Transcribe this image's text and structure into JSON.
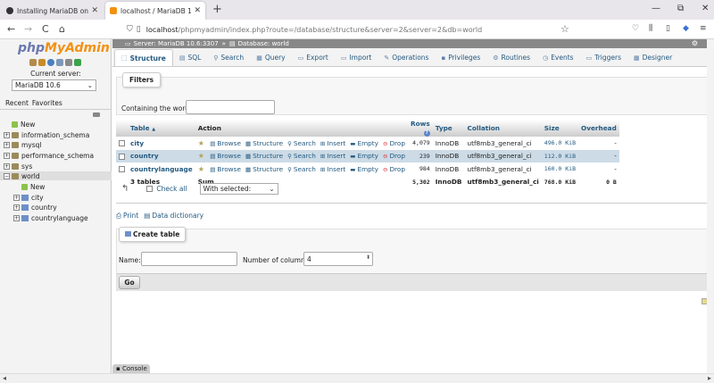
{
  "browser": {
    "tabs": [
      {
        "title": "Installing MariaDB on MS Wind",
        "close": "✕"
      },
      {
        "title": "localhost / MariaDB 10.6 / wor",
        "close": "✕"
      }
    ],
    "new_tab": "+",
    "window_controls": [
      "—",
      "⧉",
      "✕"
    ],
    "nav": {
      "back": "←",
      "forward": "→",
      "reload": "C",
      "home": "⌂"
    },
    "url_host": "localhost",
    "url_path": "/phpmyadmin/index.php?route=/database/structure&server=2&server=2&db=world",
    "right_icons": [
      "♡",
      "⫼",
      "▯",
      "◆",
      "≡"
    ]
  },
  "sidebar": {
    "logo": {
      "php": "php",
      "my": "My",
      "admin": "Admin"
    },
    "current_server_label": "Current server:",
    "server_select": "MariaDB 10.6",
    "tabs": [
      "Recent",
      "Favorites"
    ],
    "tree": [
      {
        "label": "New",
        "type": "new",
        "indent": 0
      },
      {
        "label": "information_schema",
        "type": "db",
        "indent": 0
      },
      {
        "label": "mysql",
        "type": "db",
        "indent": 0
      },
      {
        "label": "performance_schema",
        "type": "db",
        "indent": 0
      },
      {
        "label": "sys",
        "type": "db",
        "indent": 0
      },
      {
        "label": "world",
        "type": "db",
        "indent": 0,
        "selected": true
      },
      {
        "label": "New",
        "type": "new",
        "indent": 1
      },
      {
        "label": "city",
        "type": "table",
        "indent": 1
      },
      {
        "label": "country",
        "type": "table",
        "indent": 1
      },
      {
        "label": "countrylanguage",
        "type": "table",
        "indent": 1
      }
    ]
  },
  "breadcrumb": {
    "server": "Server: MariaDB 10.6:3307",
    "sep": "»",
    "database": "Database: world"
  },
  "top_tabs": [
    {
      "label": "Structure",
      "icon": "⬚",
      "active": true
    },
    {
      "label": "SQL",
      "icon": "▤"
    },
    {
      "label": "Search",
      "icon": "⚲"
    },
    {
      "label": "Query",
      "icon": "▦"
    },
    {
      "label": "Export",
      "icon": "▭"
    },
    {
      "label": "Import",
      "icon": "▭"
    },
    {
      "label": "Operations",
      "icon": "✎"
    },
    {
      "label": "Privileges",
      "icon": "▪"
    },
    {
      "label": "Routines",
      "icon": "⚙"
    },
    {
      "label": "Events",
      "icon": "◷"
    },
    {
      "label": "Triggers",
      "icon": "▭"
    },
    {
      "label": "Designer",
      "icon": "▦"
    }
  ],
  "filters": {
    "legend": "Filters",
    "label": "Containing the word:",
    "value": ""
  },
  "table": {
    "headers": {
      "table": "Table",
      "sort": "▲",
      "action": "Action",
      "rows": "Rows",
      "rows_help": "?",
      "type": "Type",
      "collation": "Collation",
      "size": "Size",
      "overhead": "Overhead"
    },
    "actions": [
      "Browse",
      "Structure",
      "Search",
      "Insert",
      "Empty",
      "Drop"
    ],
    "rows": [
      {
        "name": "city",
        "rows": "4,079",
        "type": "InnoDB",
        "collation": "utf8mb3_general_ci",
        "size": "496.0 KiB",
        "overhead": "-"
      },
      {
        "name": "country",
        "rows": "239",
        "type": "InnoDB",
        "collation": "utf8mb3_general_ci",
        "size": "112.0 KiB",
        "overhead": "-"
      },
      {
        "name": "countrylanguage",
        "rows": "984",
        "type": "InnoDB",
        "collation": "utf8mb3_general_ci",
        "size": "160.0 KiB",
        "overhead": "-"
      }
    ],
    "summary": {
      "tables": "3 tables",
      "sum": "Sum",
      "rows": "5,302",
      "type": "InnoDB",
      "collation": "utf8mb3_general_ci",
      "size": "768.0 KiB",
      "overhead": "0 B"
    }
  },
  "bulk": {
    "check_all": "Check all",
    "with_selected": "With selected:"
  },
  "links": {
    "print": "Print",
    "data_dictionary": "Data dictionary"
  },
  "create": {
    "legend": "Create table",
    "name_label": "Name:",
    "columns_label": "Number of columns:",
    "columns_value": "4",
    "go": "Go"
  },
  "console": "Console"
}
